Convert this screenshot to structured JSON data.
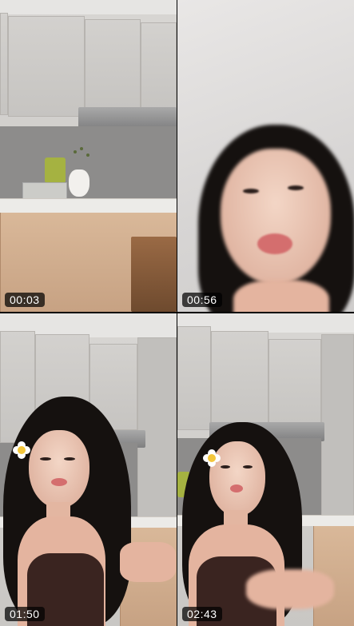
{
  "tiles": [
    {
      "name": "video-tile-1",
      "timestamp": "00:03"
    },
    {
      "name": "video-tile-2",
      "timestamp": "00:56"
    },
    {
      "name": "video-tile-3",
      "timestamp": "01:50"
    },
    {
      "name": "video-tile-4",
      "timestamp": "02:43"
    }
  ],
  "colors": {
    "timestamp_bg": "#000000b8",
    "timestamp_text": "#ffffff",
    "divider": "#000000"
  }
}
